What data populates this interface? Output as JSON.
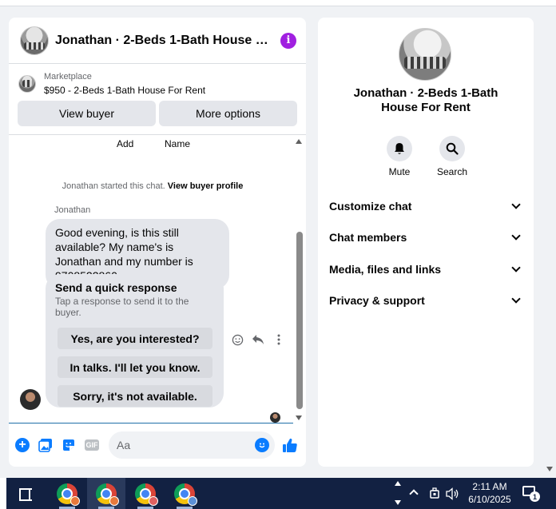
{
  "chat": {
    "title": "Jonathan · 2-Beds 1-Bath House For…",
    "info_icon": "i",
    "marketplace_label": "Marketplace",
    "listing": "$950 - 2-Beds 1-Bath House For Rent",
    "view_buyer": "View buyer",
    "more_options": "More options"
  },
  "thread": {
    "add_label": "Add",
    "name_label": "Name",
    "started_text": "Jonathan started this chat.",
    "view_profile": "View buyer profile",
    "sender": "Jonathan",
    "message": "Good evening, is this still available? My name's is Jonathan and my number is 9708522860",
    "quick_title": "Send a quick response",
    "quick_sub": "Tap a response to send it to the buyer.",
    "options": [
      "Yes, are you interested?",
      "In talks. I'll let you know.",
      "Sorry, it's not available."
    ]
  },
  "composer": {
    "placeholder": "Aa"
  },
  "info": {
    "title": "Jonathan · 2-Beds 1-Bath House For Rent",
    "mute": "Mute",
    "search": "Search",
    "sections": [
      "Customize chat",
      "Chat members",
      "Media, files and links",
      "Privacy & support"
    ]
  },
  "taskbar": {
    "time": "2:11 AM",
    "date": "6/10/2025",
    "notifications": "1"
  },
  "colors": {
    "accent": "#0a7cff",
    "info_icon": "#a01fe0",
    "taskbar": "#122142"
  }
}
